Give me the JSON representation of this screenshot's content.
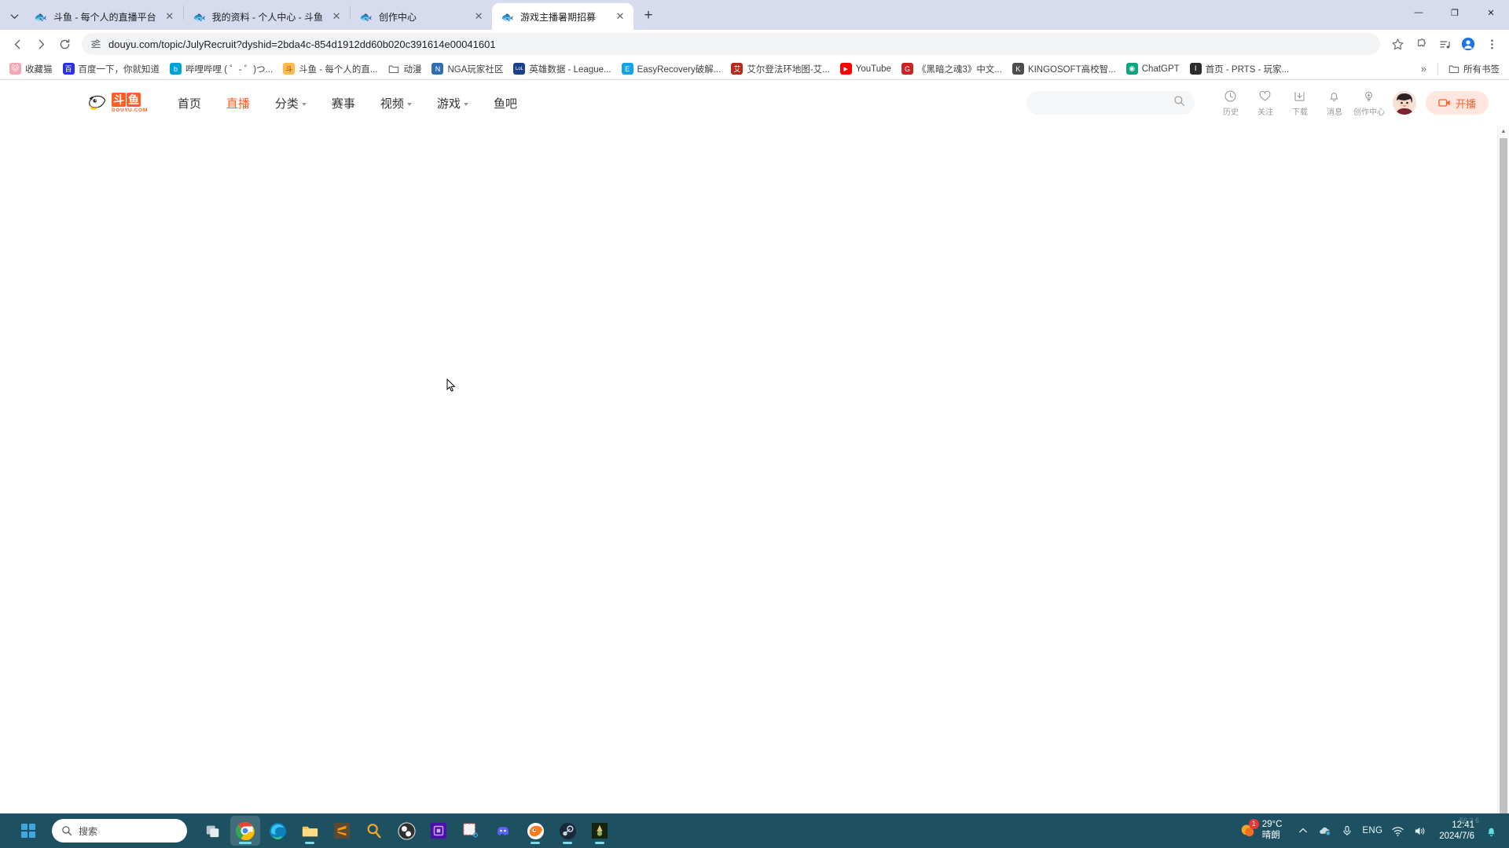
{
  "browser": {
    "tabs": [
      {
        "title": "斗鱼 - 每个人的直播平台",
        "favicon": "douyu-icon",
        "active": false
      },
      {
        "title": "我的资料 - 个人中心 - 斗鱼",
        "favicon": "douyu-icon",
        "active": false
      },
      {
        "title": "创作中心",
        "favicon": "douyu-icon",
        "active": false
      },
      {
        "title": "游戏主播暑期招募",
        "favicon": "douyu-icon",
        "active": true
      }
    ],
    "new_tab_label": "+",
    "window_controls": {
      "minimize": "—",
      "maximize": "❐",
      "close": "✕"
    },
    "toolbar": {
      "back": "back-arrow-icon",
      "forward": "forward-arrow-icon",
      "reload": "reload-icon",
      "site_info": "site-settings-icon",
      "url": "douyu.com/topic/JulyRecruit?dyshid=2bda4c-854d1912dd60b020c391614e00041601",
      "bookmark_star": "star-icon",
      "extensions": "extensions-puzzle-icon",
      "media": "media-control-icon",
      "profile": "profile-avatar-icon",
      "menu": "three-dot-menu-icon"
    },
    "bookmarks": [
      {
        "label": "收藏猫",
        "icon_color": "#f2a7b3",
        "glyph": "猫"
      },
      {
        "label": "百度一下，你就知道",
        "icon_color": "#2932e1",
        "glyph": "百"
      },
      {
        "label": "哔哩哔哩 ( ゜- ゜)つ...",
        "icon_color": "#00a1d6",
        "glyph": "b"
      },
      {
        "label": "斗鱼 - 每个人的直...",
        "icon_color": "#ff8a3d",
        "glyph": "斗"
      },
      {
        "label": "动漫",
        "icon_color": "#ffffff",
        "glyph": "folder"
      },
      {
        "label": "NGA玩家社区",
        "icon_color": "#2f6fb0",
        "glyph": "N"
      },
      {
        "label": "英雄数据 - League...",
        "icon_color": "#1b3f8b",
        "glyph": "L"
      },
      {
        "label": "EasyRecovery破解...",
        "icon_color": "#15a3e8",
        "glyph": "E"
      },
      {
        "label": "艾尔登法环地图-艾...",
        "icon_color": "#b52a1d",
        "glyph": "艾"
      },
      {
        "label": "YouTube",
        "icon_color": "#ff0000",
        "glyph": "▶"
      },
      {
        "label": "《黑暗之魂3》中文...",
        "icon_color": "#cc2222",
        "glyph": "G"
      },
      {
        "label": "KINGOSOFT高校智...",
        "icon_color": "#4d4d4d",
        "glyph": "K"
      },
      {
        "label": "ChatGPT",
        "icon_color": "#10a37f",
        "glyph": "◉"
      },
      {
        "label": "首页 - PRTS - 玩家...",
        "icon_color": "#2c2c2c",
        "glyph": "Ⅰ"
      }
    ],
    "bookmarks_overflow": "»",
    "all_bookmarks_label": "所有书签"
  },
  "site": {
    "logo": {
      "cn_chars": [
        "斗",
        "鱼"
      ],
      "domain": "DOUYU.COM"
    },
    "nav": [
      {
        "label": "首页",
        "active": false,
        "has_caret": false
      },
      {
        "label": "直播",
        "active": true,
        "has_caret": false
      },
      {
        "label": "分类",
        "active": false,
        "has_caret": true
      },
      {
        "label": "赛事",
        "active": false,
        "has_caret": false
      },
      {
        "label": "视频",
        "active": false,
        "has_caret": true
      },
      {
        "label": "游戏",
        "active": false,
        "has_caret": true
      },
      {
        "label": "鱼吧",
        "active": false,
        "has_caret": false
      }
    ],
    "search": {
      "value": "",
      "placeholder": "",
      "icon": "search-icon"
    },
    "actions": [
      {
        "label": "历史",
        "icon": "history-clock-icon"
      },
      {
        "label": "关注",
        "icon": "heart-icon"
      },
      {
        "label": "下载",
        "icon": "download-icon"
      },
      {
        "label": "消息",
        "icon": "bell-icon"
      },
      {
        "label": "创作中心",
        "icon": "lightbulb-idea-icon"
      }
    ],
    "avatar": "user-avatar",
    "live_button": {
      "label": "开播",
      "icon": "video-camera-icon",
      "color": "#ff5d23"
    }
  },
  "scrollbar": {
    "up": "▲",
    "down": "▼"
  },
  "taskbar": {
    "start": "windows-start-icon",
    "search": {
      "placeholder": "搜索",
      "icon": "search-icon"
    },
    "apps": [
      {
        "name": "task-view",
        "glyph": "❑"
      },
      {
        "name": "google-chrome",
        "glyph": "chrome"
      },
      {
        "name": "microsoft-edge",
        "glyph": "edge"
      },
      {
        "name": "file-explorer",
        "glyph": "folder"
      },
      {
        "name": "sublime-text",
        "glyph": "S"
      },
      {
        "name": "everything-search",
        "glyph": "Q"
      },
      {
        "name": "obs-studio",
        "glyph": "obs"
      },
      {
        "name": "cpu-monitor",
        "glyph": "cpu"
      },
      {
        "name": "snipping-tool",
        "glyph": "snip"
      },
      {
        "name": "discord",
        "glyph": "disc"
      },
      {
        "name": "douyu-app",
        "glyph": "douyu"
      },
      {
        "name": "steam",
        "glyph": "steam"
      },
      {
        "name": "game-app",
        "glyph": "game"
      }
    ],
    "tray": {
      "weather": {
        "temp": "29°C",
        "desc": "晴朗",
        "badge": "1"
      },
      "chevron": "^",
      "cloud_sync": "cloud-icon",
      "microphone": "microphone-icon",
      "language": "ENG",
      "wifi": "wifi-icon",
      "volume": "volume-icon",
      "clock": {
        "time": "12:41",
        "date": "2024/7/6",
        "overlay": "56 3 6"
      },
      "notification": "bell-icon"
    }
  }
}
